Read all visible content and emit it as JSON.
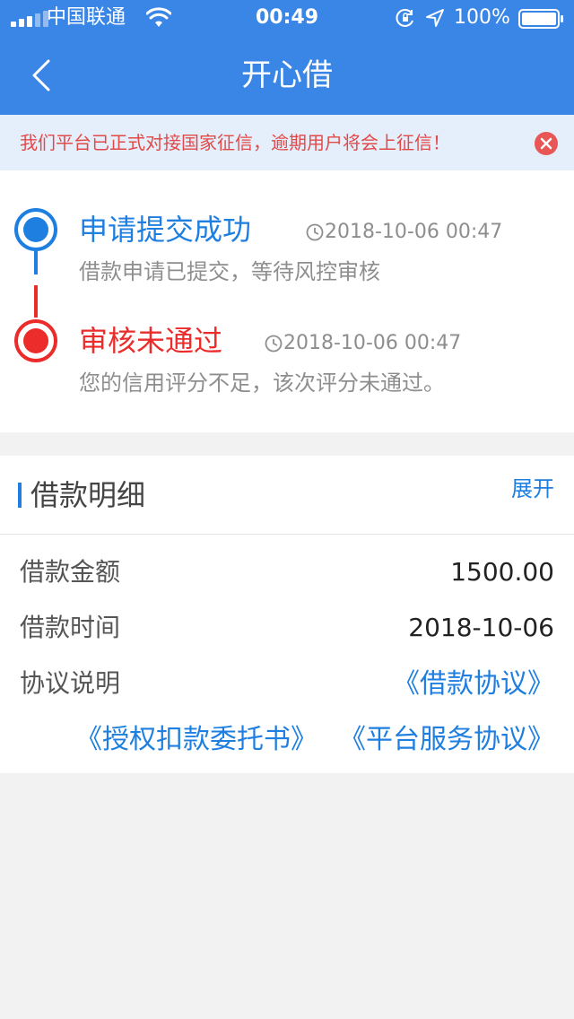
{
  "status_bar": {
    "carrier": "中国联通",
    "time": "00:49",
    "battery": "100%"
  },
  "nav": {
    "title": "开心借"
  },
  "notice": {
    "text": "我们平台已正式对接国家征信，逾期用户将会上征信！"
  },
  "timeline": [
    {
      "title": "申请提交成功",
      "time": "2018-10-06 00:47",
      "desc": "借款申请已提交，等待风控审核",
      "color": "#1e7fe0"
    },
    {
      "title": "审核未通过",
      "time": "2018-10-06 00:47",
      "desc": "您的信用评分不足，该次评分未通过。",
      "color": "#ec2b2b"
    }
  ],
  "detail": {
    "title": "借款明细",
    "expand": "展开",
    "amount_label": "借款金额",
    "amount_value": "1500.00",
    "time_label": "借款时间",
    "time_value": "2018-10-06",
    "agreement_label": "协议说明",
    "links": [
      "《借款协议》",
      "《授权扣款委托书》",
      "《平台服务协议》"
    ]
  },
  "colors": {
    "header_bg": "#3a86e6",
    "accent_blue": "#1e7fe0",
    "accent_red": "#ec2b2b",
    "notice_bg": "#e4effb"
  }
}
